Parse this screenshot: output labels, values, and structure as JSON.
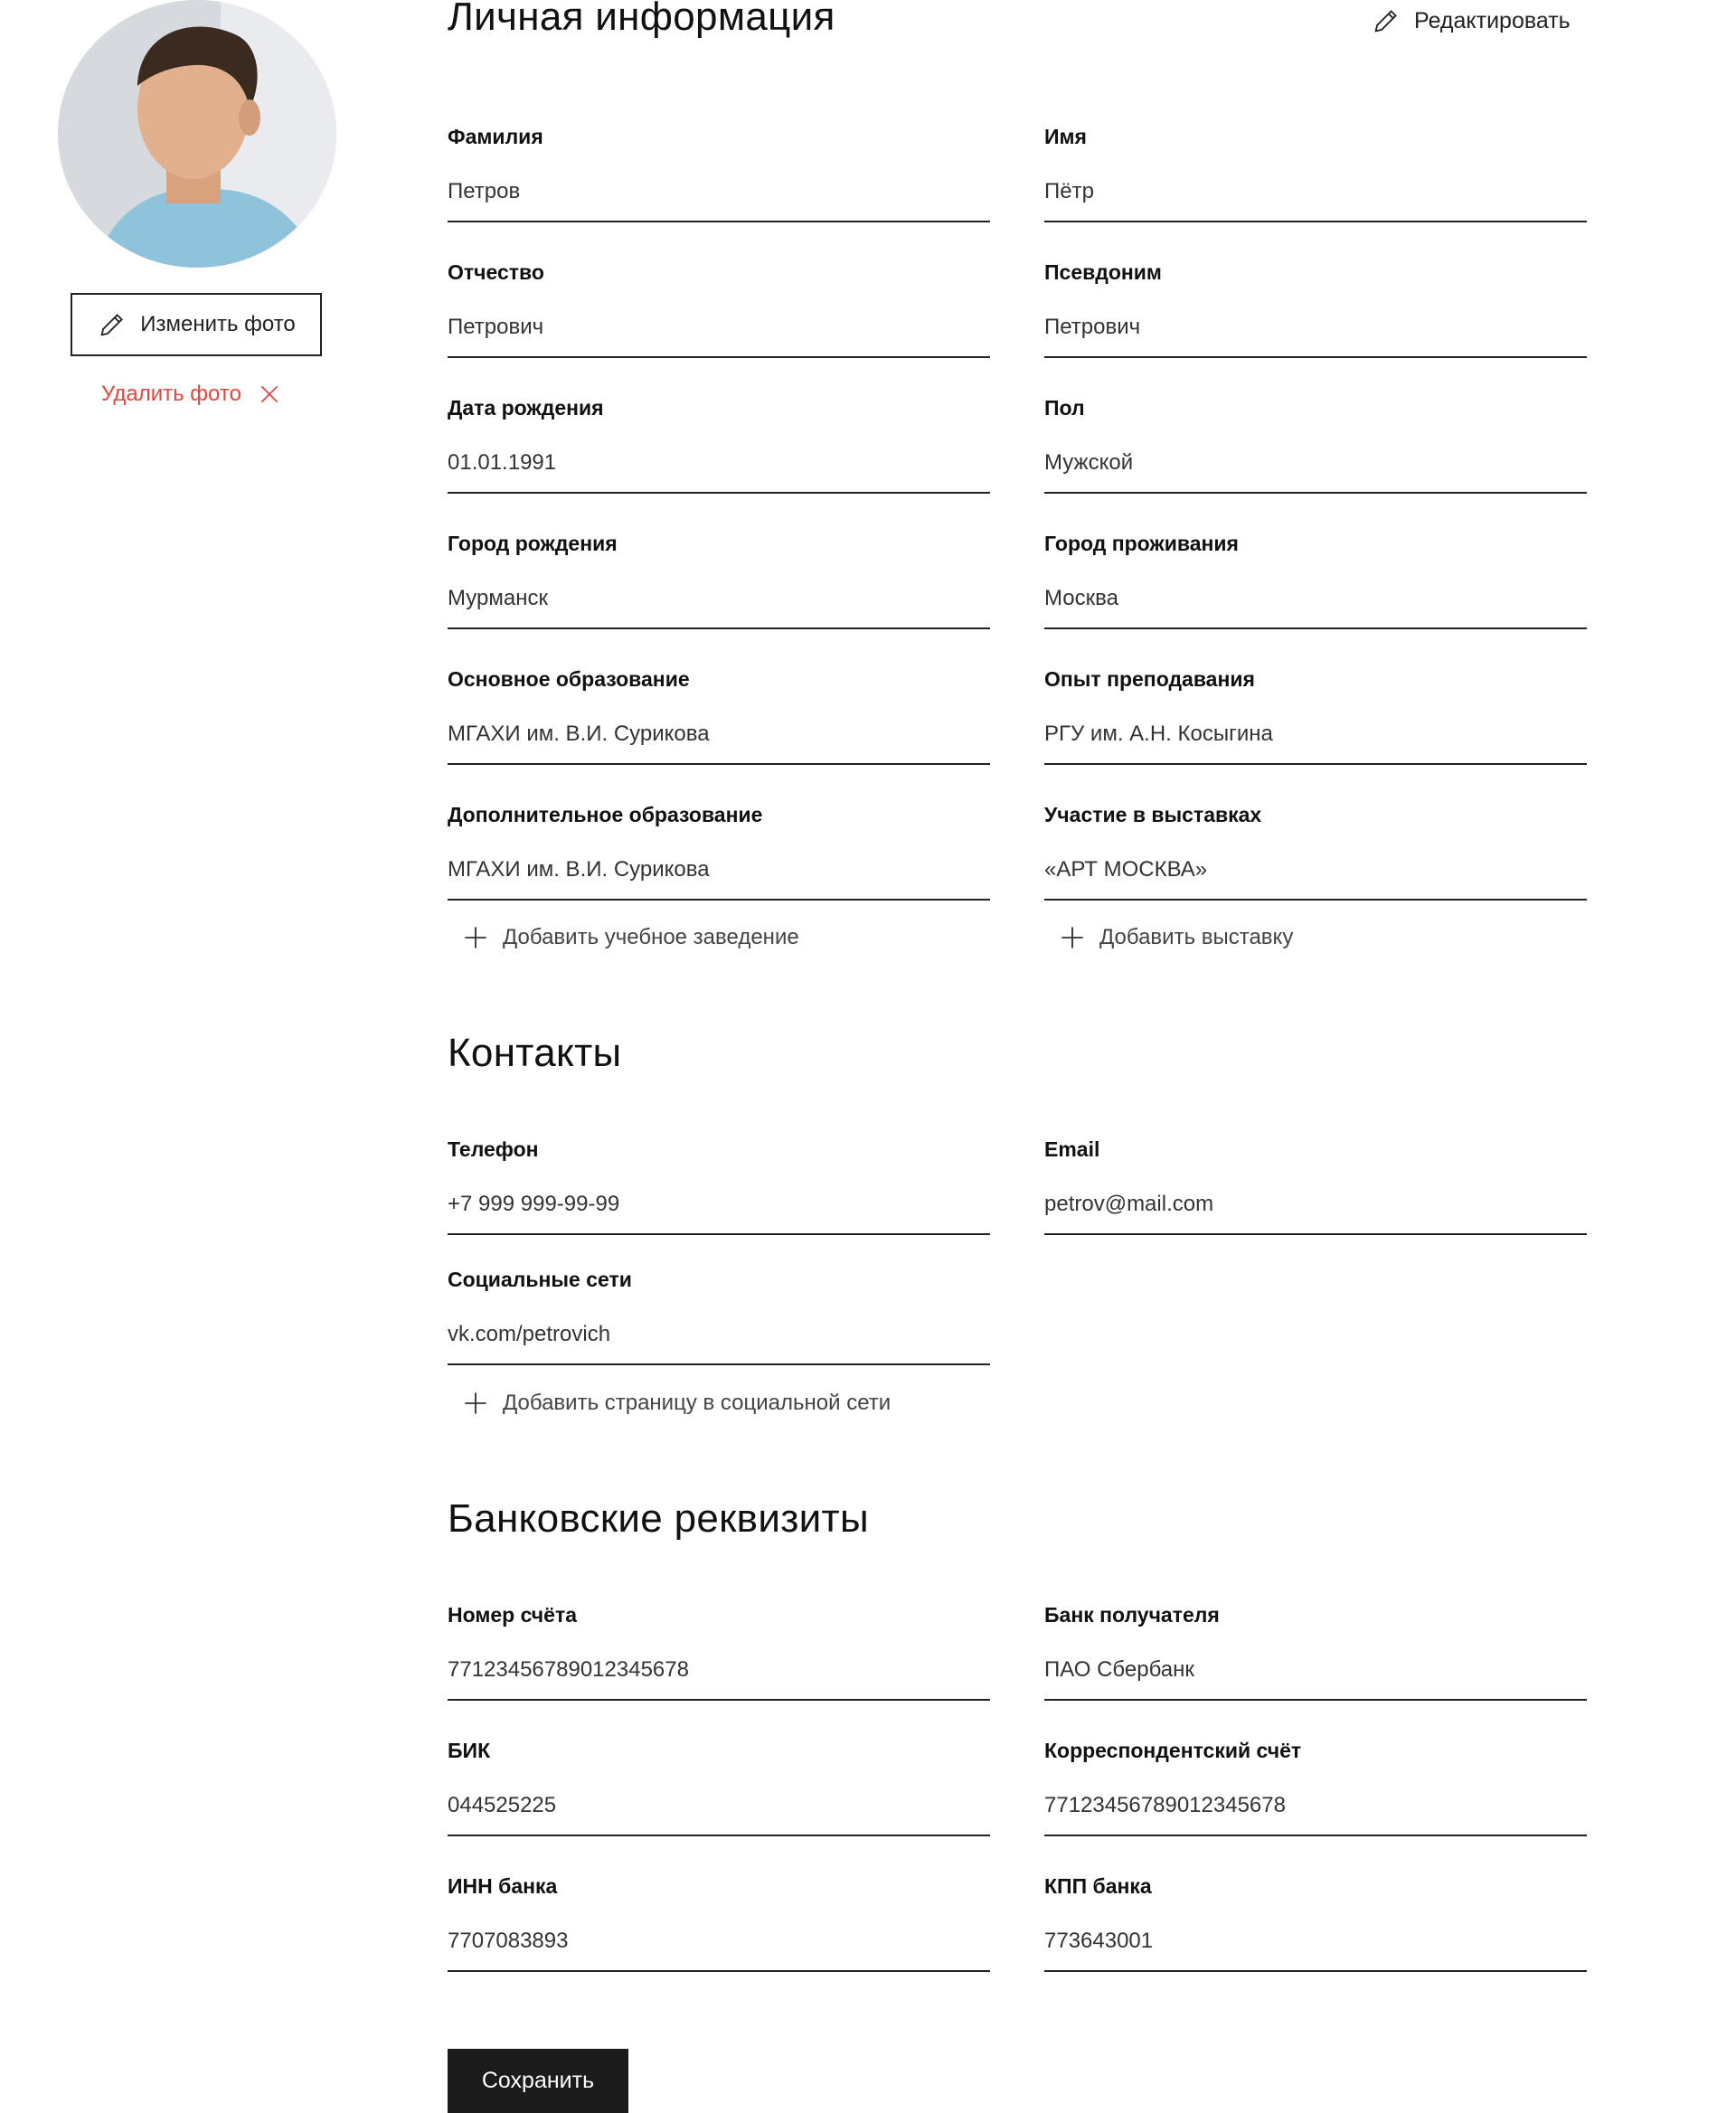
{
  "profile": {
    "change_photo_label": "Изменить фото",
    "delete_photo_label": "Удалить фото",
    "edit_label": "Редактировать"
  },
  "personal": {
    "title": "Личная информация",
    "fields": [
      {
        "label": "Фамилия",
        "value": "Петров"
      },
      {
        "label": "Имя",
        "value": "Пётр"
      },
      {
        "label": "Отчество",
        "value": "Петрович"
      },
      {
        "label": "Псевдоним",
        "value": "Петрович"
      },
      {
        "label": "Дата рождения",
        "value": "01.01.1991"
      },
      {
        "label": "Пол",
        "value": "Мужской"
      },
      {
        "label": "Город рождения",
        "value": "Мурманск"
      },
      {
        "label": "Город проживания",
        "value": "Москва"
      },
      {
        "label": "Основное образование",
        "value": "МГАХИ им. В.И. Сурикова"
      },
      {
        "label": "Опыт преподавания",
        "value": "РГУ им. А.Н. Косыгина"
      },
      {
        "label": "Дополнительное образование",
        "value": "МГАХИ им. В.И. Сурикова"
      },
      {
        "label": "Участие в выставках",
        "value": "«АРТ МОСКВА»"
      }
    ],
    "add_school_label": "Добавить учебное заведение",
    "add_exhibition_label": "Добавить выставку"
  },
  "contacts": {
    "title": "Контакты",
    "fields": [
      {
        "label": "Телефон",
        "value": "+7 999 999-99-99"
      },
      {
        "label": "Email",
        "value": "petrov@mail.com"
      },
      {
        "label": "Социальные сети",
        "value": "vk.com/petrovich"
      }
    ],
    "add_social_label": "Добавить страницу в социальной сети"
  },
  "bank": {
    "title": "Банковские реквизиты",
    "fields": [
      {
        "label": "Номер счёта",
        "value": "77123456789012345678"
      },
      {
        "label": "Банк получателя",
        "value": "ПАО Сбербанк"
      },
      {
        "label": "БИК",
        "value": "044525225"
      },
      {
        "label": "Корреспондентский счёт",
        "value": "77123456789012345678"
      },
      {
        "label": "ИНН банка",
        "value": "7707083893"
      },
      {
        "label": "КПП банка",
        "value": "773643001"
      }
    ]
  },
  "save_label": "Сохранить",
  "colors": {
    "accent_red": "#e0463b",
    "button_dark": "#1b1b1b"
  }
}
